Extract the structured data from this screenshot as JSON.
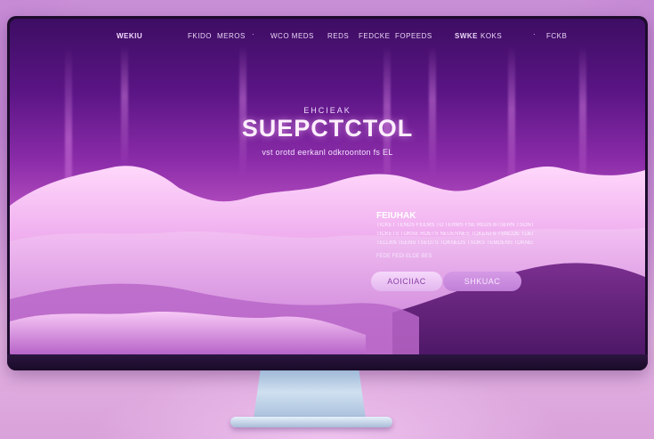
{
  "nav": {
    "logo": "WEKIU",
    "links": [
      "FKIDO",
      "MEROS",
      "·",
      "WCO MEDS",
      "REDS",
      "FEDCKE",
      "FOPEEDS"
    ],
    "right": [
      "SWKE",
      "KOKS",
      "·",
      "FCKB"
    ]
  },
  "hero": {
    "kicker": "EHCIEAK",
    "title": "SUEPCTCTOL",
    "subtitle": "vst orotd eerkanl odkroonton fs EL"
  },
  "panel": {
    "title": "FEIUHAK",
    "lines": [
      "TICKET TENDS FEEMS TO TERMS FSE REDS BTSERN TSONTEN TOMNO TOK",
      "TICKETS TOKNE ROETS NEUENNES TOKENTS TSNCOE TOEMS TEONTS TENTS",
      "TELLKN TEENS TSEOTS TOKNEDS TSOKS TEMDENS TOKNEENS TOOKS TSNED"
    ],
    "meta": "FEDE  FEDI  ELDE  BES"
  },
  "buttons": {
    "primary": "AOICIIAC",
    "secondary": "SHKUAC"
  },
  "colors": {
    "screen_top": "#3d0d63",
    "screen_mid": "#b54fc0",
    "cloud": "#f2b6f0",
    "button_primary": "#f6d9fb",
    "button_secondary": "#c07fd8",
    "stand": "#cfe0f0"
  }
}
